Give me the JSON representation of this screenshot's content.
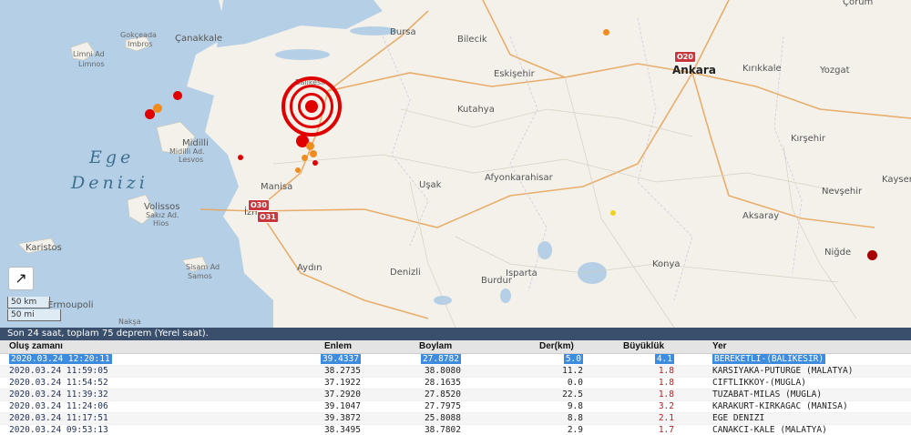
{
  "map": {
    "sea_label": [
      "Ege",
      "Denizi"
    ],
    "cities": [
      {
        "id": "gokceada",
        "text": "Gokçeada"
      },
      {
        "id": "imbros",
        "text": "Imbros"
      },
      {
        "id": "canakkale",
        "text": "Çanakkale"
      },
      {
        "id": "limni",
        "text": "Limni Ad"
      },
      {
        "id": "limnos",
        "text": "Limnos"
      },
      {
        "id": "bursa",
        "text": "Bursa"
      },
      {
        "id": "bilecik",
        "text": "Bilecik"
      },
      {
        "id": "ankara",
        "text": "Ankara"
      },
      {
        "id": "kirikkale",
        "text": "Kırıkkale"
      },
      {
        "id": "yozgat",
        "text": "Yozgat"
      },
      {
        "id": "eskisehir",
        "text": "Eskişehir"
      },
      {
        "id": "kutahya",
        "text": "Kutahya"
      },
      {
        "id": "balikesir",
        "text": "Balıkesir"
      },
      {
        "id": "midilli",
        "text": "Midilli"
      },
      {
        "id": "midilliad",
        "text": "Midilli Ad."
      },
      {
        "id": "lesvos",
        "text": "Lesvos"
      },
      {
        "id": "kirsehir",
        "text": "Kırşehir"
      },
      {
        "id": "manisa",
        "text": "Manisa"
      },
      {
        "id": "usak",
        "text": "Uşak"
      },
      {
        "id": "afyon",
        "text": "Afyonkarahisar"
      },
      {
        "id": "nevsehir",
        "text": "Nevşehir"
      },
      {
        "id": "kayseri",
        "text": "Kayser"
      },
      {
        "id": "volissos",
        "text": "Volissos"
      },
      {
        "id": "sakiz",
        "text": "Sakız Ad."
      },
      {
        "id": "hios",
        "text": "Hios"
      },
      {
        "id": "izmir",
        "text": "İzmir"
      },
      {
        "id": "aksaray",
        "text": "Aksaray"
      },
      {
        "id": "karistos",
        "text": "Karistos"
      },
      {
        "id": "nigde",
        "text": "Niğde"
      },
      {
        "id": "sisam",
        "text": "Sisam Ad"
      },
      {
        "id": "samos",
        "text": "Samos"
      },
      {
        "id": "aydin",
        "text": "Aydın"
      },
      {
        "id": "denizli",
        "text": "Denizli"
      },
      {
        "id": "burdur",
        "text": "Burdur"
      },
      {
        "id": "isparta",
        "text": "Isparta"
      },
      {
        "id": "konya",
        "text": "Konya"
      },
      {
        "id": "ermoupoli",
        "text": "Ermoupoli"
      },
      {
        "id": "naksa",
        "text": "Nakşa"
      },
      {
        "id": "corum",
        "text": "Çorum"
      }
    ],
    "road_shields": [
      "O20",
      "O30",
      "O31"
    ],
    "scale": {
      "km": "50 km",
      "mi": "50 mi"
    },
    "expand_icon": "↗",
    "colors": {
      "quake_red": "#e00000",
      "quake_orange": "#f08c1e",
      "quake_yellow": "#f0d21e",
      "quake_dark": "#a80000"
    }
  },
  "table": {
    "summary": "Son 24 saat, toplam 75 deprem (Yerel saat).",
    "headers": {
      "time": "Oluş zamanı",
      "lat": "Enlem",
      "lon": "Boylam",
      "depth": "Der(km)",
      "mag": "Büyüklük",
      "place": "Yer"
    },
    "rows": [
      {
        "time": "2020.03.24 12:20:11",
        "lat": "39.4337",
        "lon": "27.8782",
        "depth": "5.0",
        "mag": "4.1",
        "place": "BEREKETLI-(BALIKESIR)"
      },
      {
        "time": "2020.03.24 11:59:05",
        "lat": "38.2735",
        "lon": "38.8080",
        "depth": "11.2",
        "mag": "1.8",
        "place": "KARSIYAKA-PUTURGE (MALATYA)"
      },
      {
        "time": "2020.03.24 11:54:52",
        "lat": "37.1922",
        "lon": "28.1635",
        "depth": "0.0",
        "mag": "1.8",
        "place": "CIFTLIKKOY-(MUGLA)"
      },
      {
        "time": "2020.03.24 11:39:32",
        "lat": "37.2920",
        "lon": "27.8520",
        "depth": "22.5",
        "mag": "1.8",
        "place": "TUZABAT-MILAS (MUGLA)"
      },
      {
        "time": "2020.03.24 11:24:06",
        "lat": "39.1047",
        "lon": "27.7975",
        "depth": "9.8",
        "mag": "3.2",
        "place": "KARAKURT-KIRKAGAC (MANISA)"
      },
      {
        "time": "2020.03.24 11:17:51",
        "lat": "39.3872",
        "lon": "25.8088",
        "depth": "8.8",
        "mag": "2.1",
        "place": "EGE DENIZI"
      },
      {
        "time": "2020.03.24 09:53:13",
        "lat": "38.3495",
        "lon": "38.7802",
        "depth": "2.9",
        "mag": "1.7",
        "place": "CANAKCI-KALE (MALATYA)"
      }
    ]
  }
}
